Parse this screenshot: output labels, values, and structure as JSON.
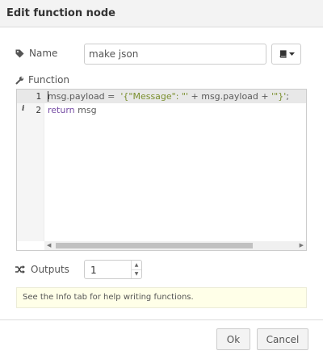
{
  "dialog": {
    "title": "Edit function node"
  },
  "name_field": {
    "label": "Name",
    "value": "make json",
    "icon": "tag-icon"
  },
  "library_button": {
    "icon": "book-icon",
    "caret": "caret-down-icon"
  },
  "function_field": {
    "label": "Function",
    "icon": "wrench-icon"
  },
  "editor": {
    "lines": [
      {
        "number": "1",
        "text": "msg.payload =  '{\"Message\": \"' + msg.payload + '\"}';"
      },
      {
        "number": "2",
        "text": "return msg"
      }
    ],
    "line2_marker": "i"
  },
  "outputs": {
    "label": "Outputs",
    "value": "1",
    "icon": "random-icon"
  },
  "tip": {
    "text": "See the Info tab for help writing functions."
  },
  "footer": {
    "ok_label": "Ok",
    "cancel_label": "Cancel"
  },
  "colors": {
    "string": "#7a8f2e",
    "keyword": "#774ea5",
    "tip_bg": "#ffffe8"
  }
}
